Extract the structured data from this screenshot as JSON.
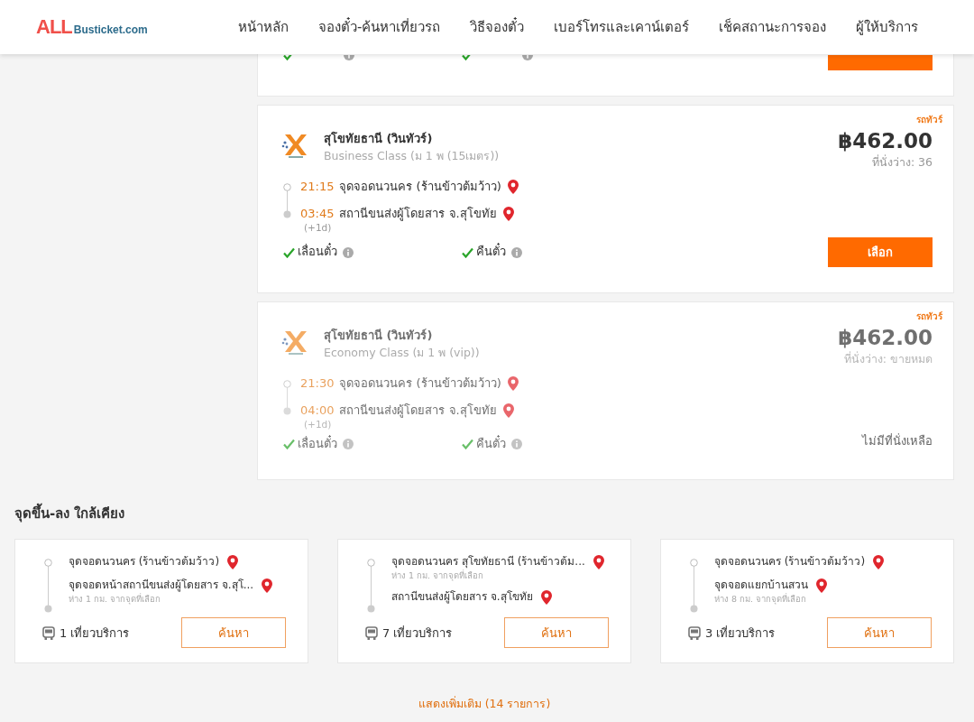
{
  "header": {
    "logo_main": "ALL",
    "logo_sub": "Busticket.com",
    "nav": [
      {
        "label": "หน้าหลัก"
      },
      {
        "label": "จองตั๋ว-ค้นหาเที่ยวรถ"
      },
      {
        "label": "วิธีจองตั๋ว"
      },
      {
        "label": "เบอร์โทรและเคาน์เตอร์"
      },
      {
        "label": "เช็คสถานะการจอง"
      },
      {
        "label": "ผู้ให้บริการ"
      }
    ]
  },
  "trips": [
    {
      "kind": "partial",
      "sold_out": false,
      "features": [
        {
          "available": true
        },
        {
          "available": true
        }
      ]
    },
    {
      "kind": "full",
      "sold_out": false,
      "badge": "รถทัวร์",
      "name": "สุโขทัยธานี (วินทัวร์)",
      "class": "Business Class (ม 1 พ (15เมตร))",
      "price": "฿462.00",
      "seats": "ที่นั่งว่าง: 36",
      "stops": [
        {
          "time": "21:15",
          "place": "จุดจอดนวนคร (ร้านข้าวต้มว้าว)"
        },
        {
          "time": "03:45",
          "place": "สถานีขนส่งผู้โดยสาร จ.สุโขทัย",
          "note": "(+1d)"
        }
      ],
      "features": [
        {
          "label": "เลื่อนตั๋ว",
          "available": true
        },
        {
          "label": "คืนตั๋ว",
          "available": true
        }
      ],
      "button": "เลือก"
    },
    {
      "kind": "full",
      "sold_out": true,
      "badge": "รถทัวร์",
      "name": "สุโขทัยธานี (วินทัวร์)",
      "class": "Economy Class (ม 1 พ (vip))",
      "price": "฿462.00",
      "seats": "ที่นั่งว่าง: ขายหมด",
      "stops": [
        {
          "time": "21:30",
          "place": "จุดจอดนวนคร (ร้านข้าวต้มว้าว)"
        },
        {
          "time": "04:00",
          "place": "สถานีขนส่งผู้โดยสาร จ.สุโขทัย",
          "note": "(+1d)"
        }
      ],
      "features": [
        {
          "label": "เลื่อนตั๋ว",
          "available": true
        },
        {
          "label": "คืนตั๋ว",
          "available": true
        }
      ],
      "status": "ไม่มีที่นั่งเหลือ"
    }
  ],
  "nearby": {
    "title": "จุดขึ้น-ลง ใกล้เคียง",
    "cards": [
      {
        "stops": [
          {
            "place": "จุดจอดนวนคร (ร้านข้าวต้มว้าว)"
          },
          {
            "place": "จุดจอดหน้าสถานีขนส่งผู้โดยสาร จ.สุโ...",
            "distance": "ห่าง 1 กม. จากจุดที่เลือก"
          }
        ],
        "trips": "1 เที่ยวบริการ",
        "button": "ค้นหา"
      },
      {
        "stops": [
          {
            "place": "จุดจอดนวนคร สุโขทัยธานี (ร้านข้าวต้ม...",
            "distance": "ห่าง 1 กม. จากจุดที่เลือก"
          },
          {
            "place": "สถานีขนส่งผู้โดยสาร จ.สุโขทัย"
          }
        ],
        "trips": "7 เที่ยวบริการ",
        "button": "ค้นหา"
      },
      {
        "stops": [
          {
            "place": "จุดจอดนวนคร (ร้านข้าวต้มว้าว)"
          },
          {
            "place": "จุดจอดแยกบ้านสวน",
            "distance": "ห่าง 8 กม. จากจุดที่เลือก"
          }
        ],
        "trips": "3 เที่ยวบริการ",
        "button": "ค้นหา"
      }
    ],
    "show_more": "แสดงเพิ่มเติม (14 รายการ)"
  }
}
